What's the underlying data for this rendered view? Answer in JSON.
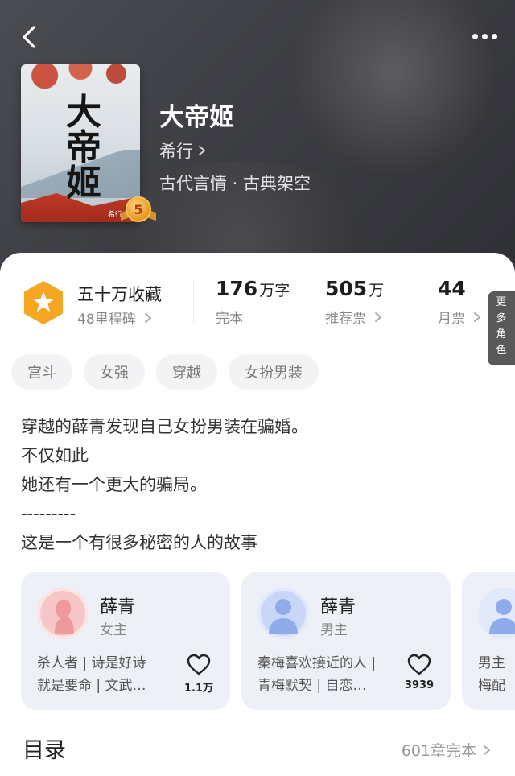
{
  "header": {
    "book_title": "大帝姬",
    "author": "希行",
    "genre": "古代言情 · 古典架空",
    "cover_title_chars": [
      "大",
      "帝",
      "姬"
    ],
    "cover_publisher": "希行/著",
    "medal_level": "5"
  },
  "stats": {
    "collection": {
      "title": "五十万收藏",
      "sub": "48里程碑"
    },
    "words": {
      "num": "176",
      "unit": "万字",
      "label": "完本"
    },
    "recommend": {
      "num": "505",
      "unit": "万",
      "label": "推荐票"
    },
    "monthly": {
      "num": "44",
      "label": "月票"
    }
  },
  "tags": [
    "宫斗",
    "女强",
    "穿越",
    "女扮男装"
  ],
  "description": [
    "穿越的薛青发现自己女扮男装在骗婚。",
    "不仅如此",
    "她还有一个更大的骗局。",
    "---------",
    "这是一个有很多秘密的人的故事"
  ],
  "roles": [
    {
      "name": "薛青",
      "type": "女主",
      "desc_line1": "杀人者 | 诗是好诗",
      "desc_line2": "就是要命 | 文武…",
      "likes": "1.1万"
    },
    {
      "name": "薛青",
      "type": "男主",
      "desc_line1": "秦梅喜欢接近的人 |",
      "desc_line2": "青梅默契 | 自恋…",
      "likes": "3939"
    },
    {
      "name": "",
      "type": "",
      "desc_line1": "男主",
      "desc_line2": "梅配",
      "likes": ""
    }
  ],
  "more_roles_label": [
    "更",
    "多",
    "角",
    "色"
  ],
  "toc": {
    "title": "目录",
    "status": "601章完本"
  },
  "colors": {
    "accent": "#f5a623",
    "panel_bg": "#ffffff",
    "card_bg": "#eef0f8"
  }
}
